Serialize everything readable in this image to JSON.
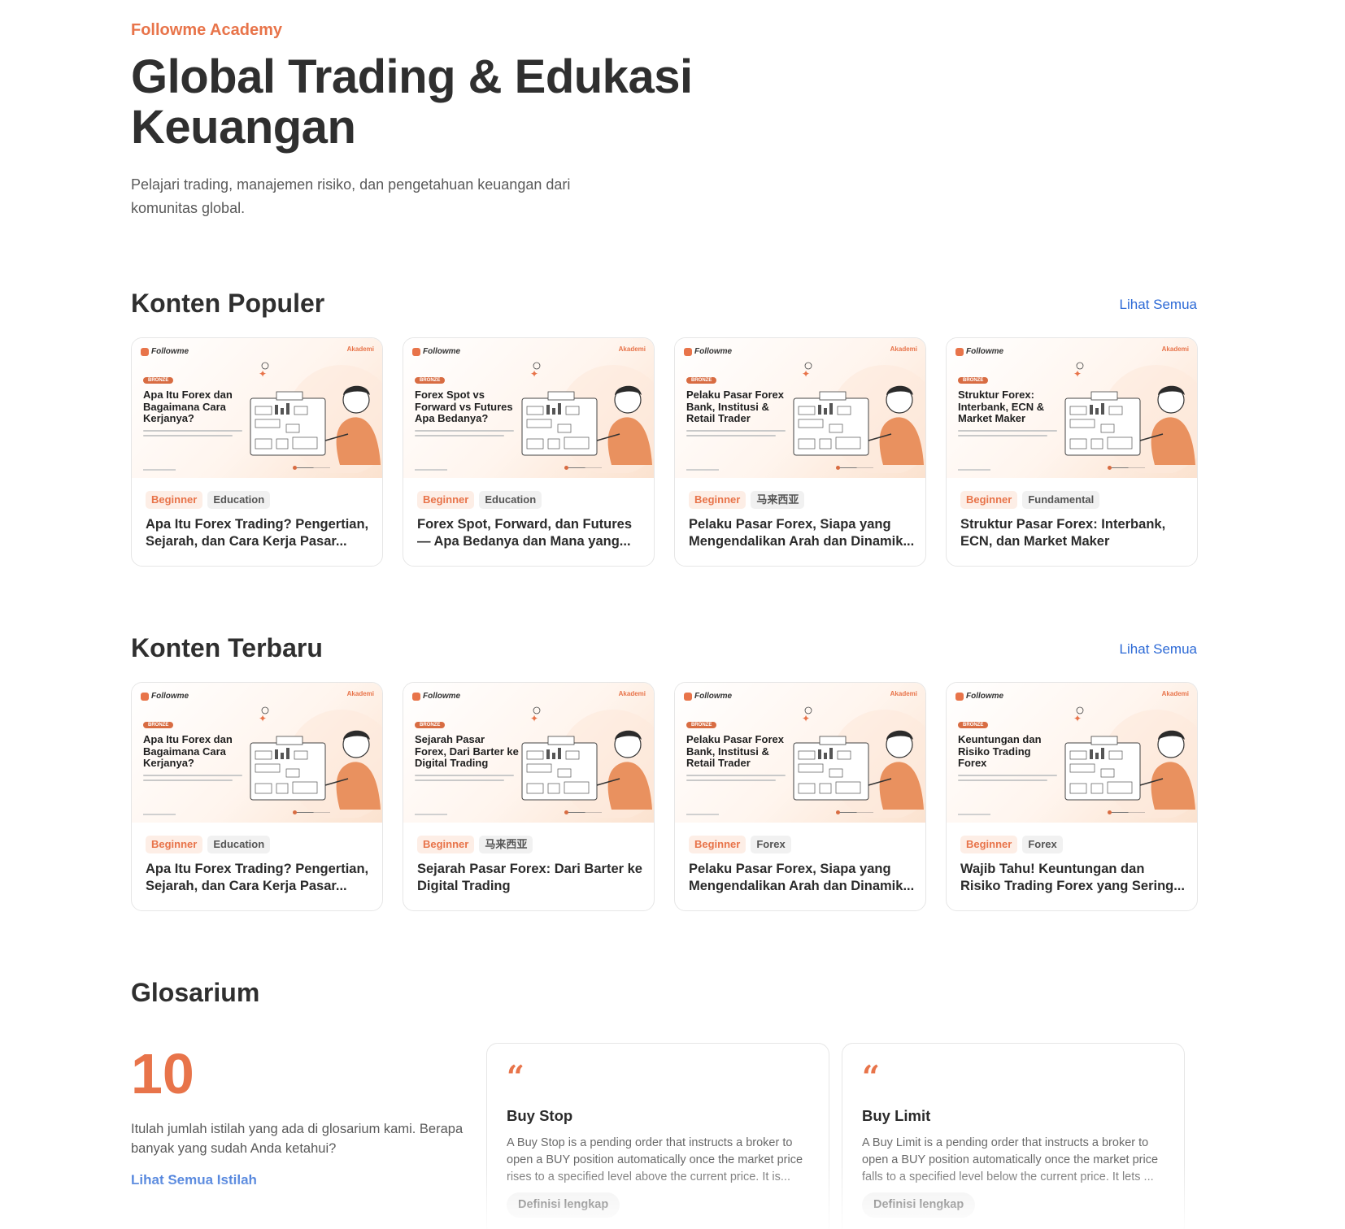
{
  "hero": {
    "eyebrow": "Followme Academy",
    "title": "Global Trading & Edukasi Keuangan",
    "subtitle": "Pelajari trading, manajemen risiko, dan pengetahuan keuangan dari komunitas global."
  },
  "thumb_common": {
    "logo": "Followme",
    "akademi": "Akademi",
    "badge": "BRONZE"
  },
  "popular": {
    "title": "Konten Populer",
    "see_all": "Lihat Semua",
    "cards": [
      {
        "thumb_title": "Apa Itu Forex dan Bagaimana Cara Kerjanya?",
        "level": "Beginner",
        "category": "Education",
        "title": "Apa Itu Forex Trading? Pengertian, Sejarah, dan Cara Kerja Pasar..."
      },
      {
        "thumb_title": "Forex Spot vs Forward vs Futures Apa Bedanya?",
        "level": "Beginner",
        "category": "Education",
        "title": "Forex Spot, Forward, dan Futures — Apa Bedanya dan Mana yang..."
      },
      {
        "thumb_title": "Pelaku Pasar Forex Bank, Institusi & Retail Trader",
        "level": "Beginner",
        "category": "马来西亚",
        "title": "Pelaku Pasar Forex, Siapa yang Mengendalikan Arah dan Dinamik..."
      },
      {
        "thumb_title": "Struktur Forex: Interbank, ECN & Market Maker",
        "level": "Beginner",
        "category": "Fundamental",
        "title": "Struktur Pasar Forex: Interbank, ECN, dan Market Maker"
      }
    ]
  },
  "latest": {
    "title": "Konten Terbaru",
    "see_all": "Lihat Semua",
    "cards": [
      {
        "thumb_title": "Apa Itu Forex dan Bagaimana Cara Kerjanya?",
        "level": "Beginner",
        "category": "Education",
        "title": "Apa Itu Forex Trading? Pengertian, Sejarah, dan Cara Kerja Pasar..."
      },
      {
        "thumb_title": "Sejarah Pasar Forex, Dari Barter ke Digital Trading",
        "level": "Beginner",
        "category": "马来西亚",
        "title": "Sejarah Pasar Forex: Dari Barter ke Digital Trading"
      },
      {
        "thumb_title": "Pelaku Pasar Forex Bank, Institusi & Retail Trader",
        "level": "Beginner",
        "category": "Forex",
        "title": "Pelaku Pasar Forex, Siapa yang Mengendalikan Arah dan Dinamik..."
      },
      {
        "thumb_title": "Keuntungan dan Risiko Trading Forex",
        "level": "Beginner",
        "category": "Forex",
        "title": "Wajib Tahu! Keuntungan dan Risiko Trading Forex yang Sering..."
      }
    ]
  },
  "glossary": {
    "title": "Glosarium",
    "count": "10",
    "description": "Itulah jumlah istilah yang ada di glosarium kami. Berapa banyak yang sudah Anda ketahui?",
    "link": "Lihat Semua Istilah",
    "quote_mark": "“",
    "items": [
      {
        "term": "Buy Stop",
        "definition": "A Buy Stop is a pending order that instructs a broker to open a BUY position automatically once the market price rises to a specified level above the current price. It is...",
        "button": "Definisi lengkap"
      },
      {
        "term": "Buy Limit",
        "definition": "A Buy Limit is a pending order that instructs a broker to open a BUY position automatically once the market price falls to a specified level below the current price. It lets ...",
        "button": "Definisi lengkap"
      }
    ]
  },
  "colors": {
    "accent": "#e8744a",
    "link": "#2d6ad6",
    "text": "#2f2f2f"
  }
}
